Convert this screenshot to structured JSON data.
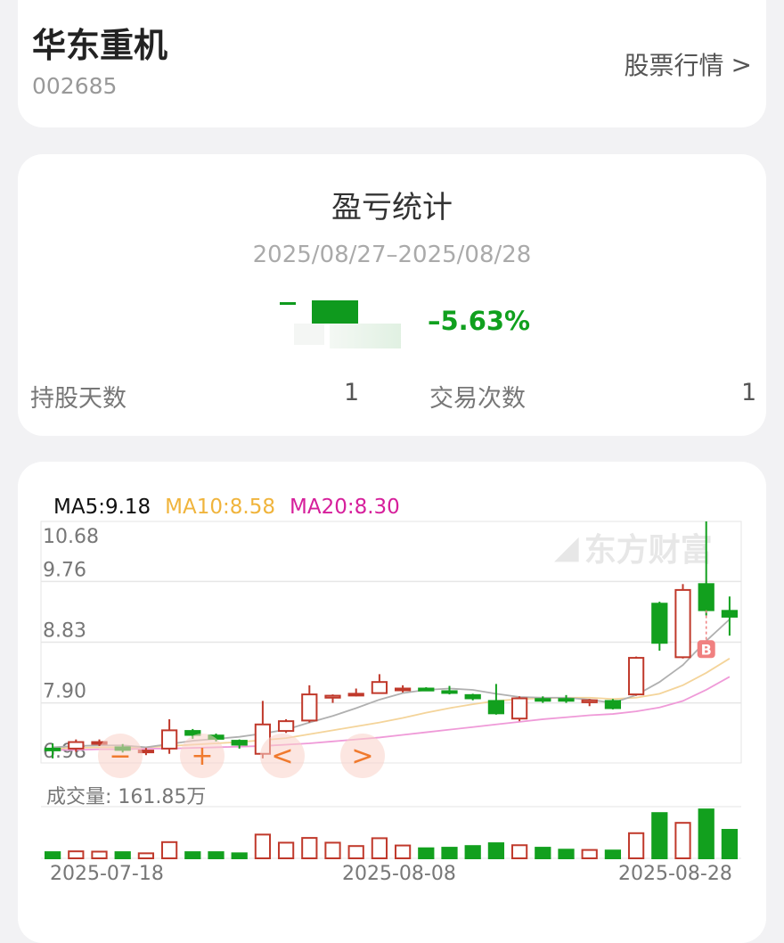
{
  "stock": {
    "name": "华东重机",
    "code": "002685",
    "quote_link": "股票行情"
  },
  "profit_loss": {
    "title": "盈亏统计",
    "date_range": "2025/08/27–2025/08/28",
    "percent": "–5.63%",
    "holding_days_label": "持股天数",
    "holding_days_value": "1",
    "trade_count_label": "交易次数",
    "trade_count_value": "1"
  },
  "colors": {
    "up": "#c0392b",
    "down": "#12a01e",
    "ma5": "#b0b0b0",
    "ma10": "#f4d49a",
    "ma20": "#ef9ad8"
  },
  "chart_data": {
    "type": "candlestick",
    "ma_labels": [
      {
        "text": "MA5:9.18",
        "color": "#111111"
      },
      {
        "text": "MA10:8.58",
        "color": "#f0b43c"
      },
      {
        "text": "MA20:8.30",
        "color": "#d61f9b"
      }
    ],
    "y_ticks": [
      "10.68",
      "9.76",
      "8.83",
      "7.90",
      "6.98"
    ],
    "ylim": [
      6.98,
      10.68
    ],
    "watermark": "东方财富",
    "volume_label": "成交量: 161.85万",
    "x_labels": [
      "2025-07-18",
      "2025-08-08",
      "2025-08-28"
    ],
    "buy_marker": "B",
    "candles": [
      {
        "o": 7.2,
        "c": 7.18,
        "h": 7.28,
        "l": 7.05
      },
      {
        "o": 7.2,
        "c": 7.3,
        "h": 7.34,
        "l": 7.15
      },
      {
        "o": 7.28,
        "c": 7.3,
        "h": 7.34,
        "l": 7.24
      },
      {
        "o": 7.22,
        "c": 7.18,
        "h": 7.27,
        "l": 7.14
      },
      {
        "o": 7.15,
        "c": 7.17,
        "h": 7.21,
        "l": 7.1
      },
      {
        "o": 7.2,
        "c": 7.48,
        "h": 7.65,
        "l": 7.12
      },
      {
        "o": 7.47,
        "c": 7.41,
        "h": 7.5,
        "l": 7.35
      },
      {
        "o": 7.4,
        "c": 7.35,
        "h": 7.43,
        "l": 7.31
      },
      {
        "o": 7.32,
        "c": 7.26,
        "h": 7.34,
        "l": 7.2
      },
      {
        "o": 7.12,
        "c": 7.57,
        "h": 7.93,
        "l": 7.05
      },
      {
        "o": 7.47,
        "c": 7.62,
        "h": 7.65,
        "l": 7.44
      },
      {
        "o": 7.63,
        "c": 8.03,
        "h": 8.17,
        "l": 7.6
      },
      {
        "o": 7.98,
        "c": 8.01,
        "h": 8.03,
        "l": 7.9
      },
      {
        "o": 8.03,
        "c": 8.04,
        "h": 8.12,
        "l": 8.0
      },
      {
        "o": 8.05,
        "c": 8.22,
        "h": 8.34,
        "l": 8.04
      },
      {
        "o": 8.1,
        "c": 8.12,
        "h": 8.17,
        "l": 8.06
      },
      {
        "o": 8.12,
        "c": 8.09,
        "h": 8.14,
        "l": 8.08
      },
      {
        "o": 8.08,
        "c": 8.06,
        "h": 8.16,
        "l": 8.03
      },
      {
        "o": 8.02,
        "c": 7.97,
        "h": 8.04,
        "l": 7.94
      },
      {
        "o": 7.93,
        "c": 7.74,
        "h": 8.19,
        "l": 7.72
      },
      {
        "o": 7.66,
        "c": 7.97,
        "h": 8.0,
        "l": 7.62
      },
      {
        "o": 7.96,
        "c": 7.95,
        "h": 8.0,
        "l": 7.9
      },
      {
        "o": 7.96,
        "c": 7.95,
        "h": 8.02,
        "l": 7.9
      },
      {
        "o": 7.91,
        "c": 7.94,
        "h": 7.96,
        "l": 7.85
      },
      {
        "o": 7.93,
        "c": 7.82,
        "h": 7.96,
        "l": 7.8
      },
      {
        "o": 8.03,
        "c": 8.59,
        "h": 8.61,
        "l": 8.01
      },
      {
        "o": 9.42,
        "c": 8.82,
        "h": 9.45,
        "l": 8.7
      },
      {
        "o": 8.6,
        "c": 9.63,
        "h": 9.72,
        "l": 8.58
      },
      {
        "o": 9.72,
        "c": 9.32,
        "h": 10.68,
        "l": 9.24
      },
      {
        "o": 9.31,
        "c": 9.22,
        "h": 9.53,
        "l": 8.93
      }
    ],
    "ma5": [
      7.22,
      7.24,
      7.25,
      7.25,
      7.22,
      7.27,
      7.32,
      7.35,
      7.38,
      7.43,
      7.49,
      7.6,
      7.7,
      7.82,
      7.95,
      8.05,
      8.1,
      8.12,
      8.1,
      8.04,
      7.99,
      7.98,
      7.98,
      7.95,
      7.9,
      8.02,
      8.22,
      8.48,
      8.85,
      9.18
    ],
    "ma10": [
      7.2,
      7.21,
      7.22,
      7.22,
      7.22,
      7.24,
      7.26,
      7.28,
      7.3,
      7.33,
      7.36,
      7.42,
      7.48,
      7.54,
      7.6,
      7.67,
      7.75,
      7.82,
      7.88,
      7.93,
      7.96,
      7.97,
      7.98,
      7.98,
      7.96,
      7.98,
      8.04,
      8.17,
      8.36,
      8.58
    ],
    "ma20": [
      7.18,
      7.18,
      7.19,
      7.19,
      7.2,
      7.2,
      7.21,
      7.22,
      7.23,
      7.24,
      7.26,
      7.28,
      7.31,
      7.34,
      7.37,
      7.41,
      7.45,
      7.49,
      7.53,
      7.57,
      7.61,
      7.65,
      7.68,
      7.71,
      7.73,
      7.77,
      7.83,
      7.93,
      8.1,
      8.3
    ],
    "volume": [
      0.22,
      0.25,
      0.24,
      0.22,
      0.18,
      0.58,
      0.22,
      0.22,
      0.18,
      0.85,
      0.56,
      0.73,
      0.56,
      0.44,
      0.72,
      0.46,
      0.36,
      0.38,
      0.44,
      0.54,
      0.47,
      0.38,
      0.31,
      0.3,
      0.28,
      0.9,
      1.62,
      1.27,
      1.75,
      1.02
    ],
    "vol_max": 1.85,
    "buy_index": 28
  }
}
